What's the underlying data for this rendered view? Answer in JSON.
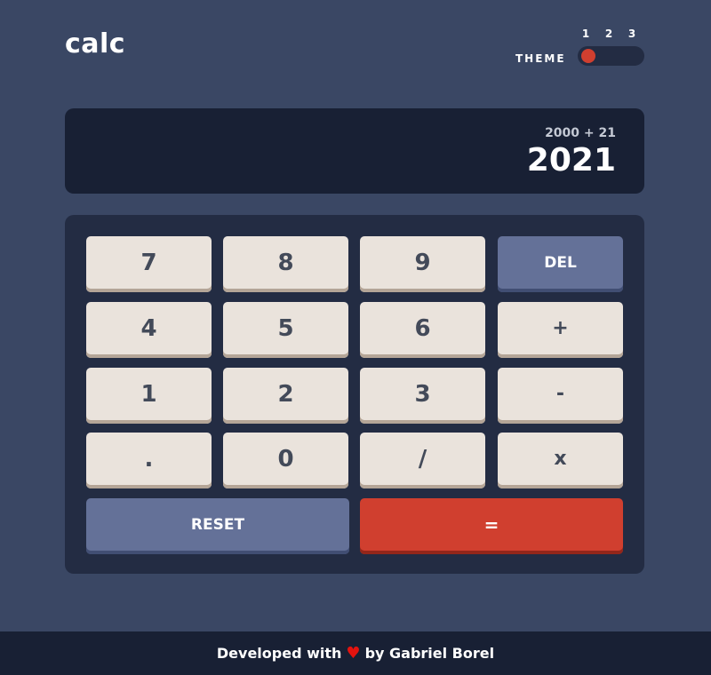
{
  "header": {
    "logo": "calc",
    "theme_label": "THEME",
    "theme_options": [
      "1",
      "2",
      "3"
    ],
    "active_theme": "1"
  },
  "display": {
    "expression": "2000 + 21",
    "result": "2021"
  },
  "keys": {
    "k7": "7",
    "k8": "8",
    "k9": "9",
    "del": "DEL",
    "k4": "4",
    "k5": "5",
    "k6": "6",
    "plus": "+",
    "k1": "1",
    "k2": "2",
    "k3": "3",
    "minus": "-",
    "dot": ".",
    "k0": "0",
    "divide": "/",
    "multiply": "x",
    "reset": "RESET",
    "equals": "="
  },
  "footer": {
    "prefix": "Developed with",
    "heart": "♥",
    "suffix": "by Gabriel Borel"
  },
  "colors": {
    "background": "#3a4764",
    "display_bg": "#182034",
    "keypad_bg": "#232c43",
    "key_bg": "#eae3dc",
    "key_text": "#434a59",
    "accent_blue": "#647198",
    "accent_red": "#d03f2f"
  }
}
